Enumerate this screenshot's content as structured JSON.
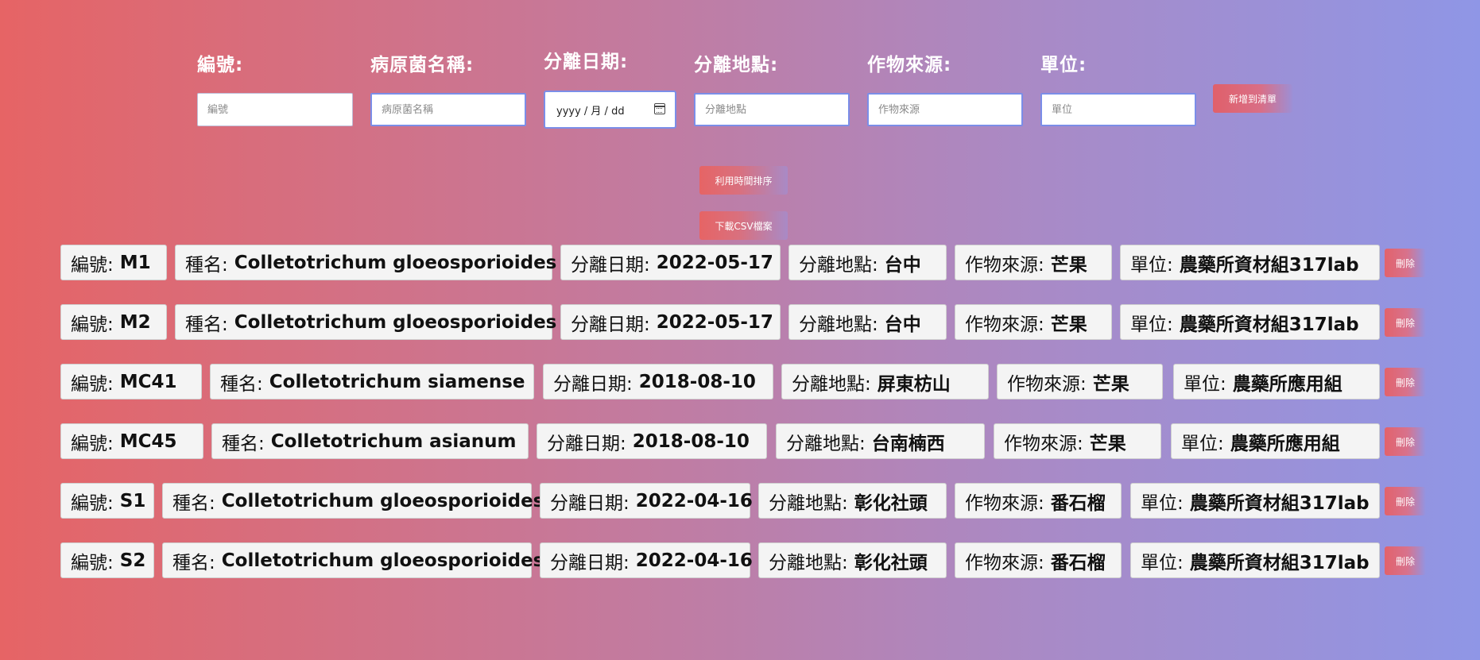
{
  "form": {
    "id": {
      "label": "編號:",
      "placeholder": "編號"
    },
    "pathogen": {
      "label": "病原菌名稱:",
      "placeholder": "病原菌名稱"
    },
    "date": {
      "label": "分離日期:",
      "placeholder": "yyyy / 月 / dd"
    },
    "location": {
      "label": "分離地點:",
      "placeholder": "分離地點"
    },
    "crop": {
      "label": "作物來源:",
      "placeholder": "作物來源"
    },
    "unit": {
      "label": "單位:",
      "placeholder": "單位"
    },
    "add_button": "新增到清單"
  },
  "actions": {
    "sort_button": "利用時間排序",
    "csv_button": "下載CSV檔案"
  },
  "records": [
    {
      "id_label": "編號:",
      "id": "M1",
      "species_label": "種名:",
      "species": "Colletotrichum gloeosporioides",
      "date_label": "分離日期:",
      "date": "2022-05-17",
      "location_label": "分離地點:",
      "location": "台中",
      "crop_label": "作物來源:",
      "crop": "芒果",
      "unit_label": "單位:",
      "unit": "農藥所資材組317lab",
      "delete": "刪除"
    },
    {
      "id_label": "編號:",
      "id": "M2",
      "species_label": "種名:",
      "species": "Colletotrichum gloeosporioides",
      "date_label": "分離日期:",
      "date": "2022-05-17",
      "location_label": "分離地點:",
      "location": "台中",
      "crop_label": "作物來源:",
      "crop": "芒果",
      "unit_label": "單位:",
      "unit": "農藥所資材組317lab",
      "delete": "刪除"
    },
    {
      "id_label": "編號:",
      "id": "MC41",
      "species_label": "種名:",
      "species": "Colletotrichum siamense",
      "date_label": "分離日期:",
      "date": "2018-08-10",
      "location_label": "分離地點:",
      "location": "屏東枋山",
      "crop_label": "作物來源:",
      "crop": "芒果",
      "unit_label": "單位:",
      "unit": "農藥所應用組",
      "delete": "刪除"
    },
    {
      "id_label": "編號:",
      "id": "MC45",
      "species_label": "種名:",
      "species": "Colletotrichum asianum",
      "date_label": "分離日期:",
      "date": "2018-08-10",
      "location_label": "分離地點:",
      "location": "台南楠西",
      "crop_label": "作物來源:",
      "crop": "芒果",
      "unit_label": "單位:",
      "unit": "農藥所應用組",
      "delete": "刪除"
    },
    {
      "id_label": "編號:",
      "id": "S1",
      "species_label": "種名:",
      "species": "Colletotrichum gloeosporioides",
      "date_label": "分離日期:",
      "date": "2022-04-16",
      "location_label": "分離地點:",
      "location": "彰化社頭",
      "crop_label": "作物來源:",
      "crop": "番石榴",
      "unit_label": "單位:",
      "unit": "農藥所資材組317lab",
      "delete": "刪除"
    },
    {
      "id_label": "編號:",
      "id": "S2",
      "species_label": "種名:",
      "species": "Colletotrichum gloeosporioides",
      "date_label": "分離日期:",
      "date": "2022-04-16",
      "location_label": "分離地點:",
      "location": "彰化社頭",
      "crop_label": "作物來源:",
      "crop": "番石榴",
      "unit_label": "單位:",
      "unit": "農藥所資材組317lab",
      "delete": "刪除"
    }
  ]
}
